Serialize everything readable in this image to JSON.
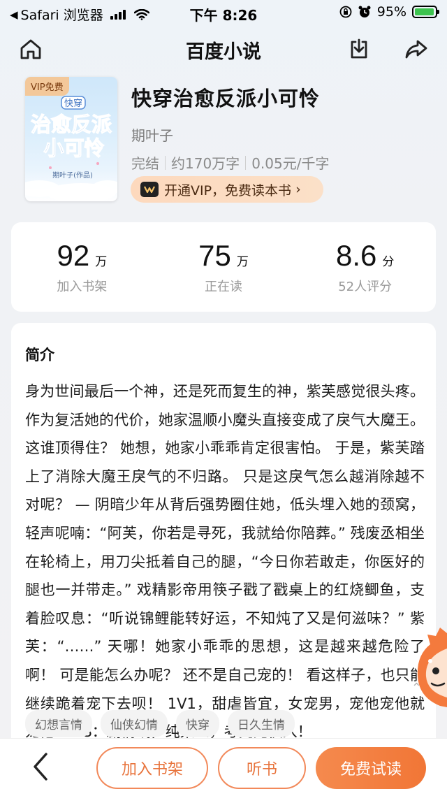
{
  "status_bar": {
    "back_app": "Safari 浏览器",
    "time": "下午 8:26",
    "battery_percent": "95%",
    "battery_level": 0.95
  },
  "nav": {
    "title": "百度小说"
  },
  "book": {
    "cover_badge": "VIP免费",
    "cover_tag": "快穿",
    "cover_title_1": "治愈反派",
    "cover_title_2": "小可怜",
    "cover_author": "期叶子(作品)",
    "title": "快穿治愈反派小可怜",
    "author": "期叶子",
    "status": "完结",
    "word_count": "约170万字",
    "price": "0.05元/千字",
    "vip_button": "开通VIP，免费读本书",
    "vip_button_chevron": "›"
  },
  "stats": [
    {
      "value": "92",
      "unit": "万",
      "label": "加入书架"
    },
    {
      "value": "75",
      "unit": "万",
      "label": "正在读"
    },
    {
      "value": "8.6",
      "unit": "分",
      "label": "52人评分"
    }
  ],
  "intro": {
    "heading": "简介",
    "text": "身为世间最后一个神，还是死而复生的神，紫芙感觉很头疼。 作为复活她的代价，她家温顺小魔头直接变成了戾气大魔王。 这谁顶得住？ 她想，她家小乖乖肯定很害怕。 于是，紫芙踏上了消除大魔王戾气的不归路。 只是这戾气怎么越消除越不对呢？ — 阴暗少年从背后强势圈住她，低头埋入她的颈窝，轻声呢喃：“阿芙，你若是寻死，我就给你陪葬。” 残废丞相坐在轮椅上，用刀尖抵着自己的腿，“今日你若敢走，你医好的腿也一并带走。” 戏精影帝用筷子戳了戳桌上的红烧鲫鱼，支着脸叹息：“听说锦鲤能转好运，不知炖了又是何滋味？” 紫芙：“……” 天哪！她家小乖乖的思想，这是越来越危险了啊！ 可是能怎么办呢？ 还不是自己宠的！ 看这样子，也只能继续跪着宠下去呗！ 1V1，甜虐皆宜，女宠男，宠他宠他就宠他！ PS：剧情线，纯架空，考究党慎入！",
    "collapse_icon": "⌃",
    "tags": [
      "幻想言情",
      "仙侠幻情",
      "快穿",
      "日久生情"
    ]
  },
  "bottom_bar": {
    "add_shelf": "加入书架",
    "listen": "听书",
    "free_read": "免费试读"
  },
  "colors": {
    "accent": "#f17636",
    "vip_bg": "#fddcc2",
    "battery": "#3dc34f"
  },
  "icons": [
    "back-arrow-icon",
    "signal-icon",
    "wifi-icon",
    "lock-rotation-icon",
    "alarm-icon",
    "battery-icon",
    "home-icon",
    "download-icon",
    "share-icon",
    "vip-crown-icon",
    "chevron-left-icon",
    "mascot-icon"
  ]
}
